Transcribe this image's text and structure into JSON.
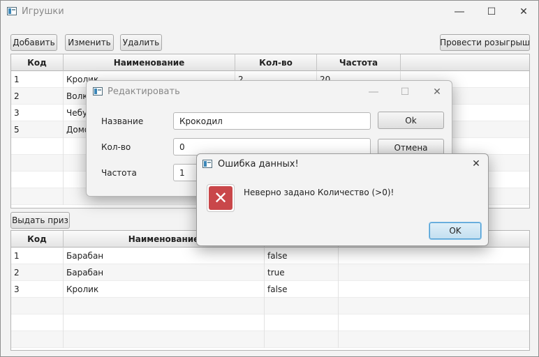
{
  "main": {
    "title": "Игрушки",
    "toolbar": {
      "add": "Добавить",
      "edit": "Изменить",
      "delete": "Удалить",
      "draw": "Провести розыгрыш"
    },
    "toys_table": {
      "headers": [
        "Код",
        "Наименование",
        "Кол-во",
        "Частота"
      ],
      "rows": [
        [
          "1",
          "Кролик",
          "2",
          "20"
        ],
        [
          "2",
          "Волк",
          "",
          ""
        ],
        [
          "3",
          "Чебур",
          "",
          ""
        ],
        [
          "5",
          "Домо",
          "",
          ""
        ]
      ]
    },
    "give_prize": "Выдать приз",
    "prizes_table": {
      "headers": [
        "Код",
        "Наименование",
        ""
      ],
      "rows": [
        [
          "1",
          "Барабан",
          "false"
        ],
        [
          "2",
          "Барабан",
          "true"
        ],
        [
          "3",
          "Кролик",
          "false"
        ]
      ]
    }
  },
  "edit_dialog": {
    "title": "Редактировать",
    "name_label": "Название",
    "name_value": "Крокодил",
    "qty_label": "Кол-во",
    "qty_value": "0",
    "freq_label": "Частота",
    "freq_value": "1",
    "ok": "Ok",
    "cancel": "Отмена"
  },
  "error_dialog": {
    "title": "Ошибка данных!",
    "message": "Неверно задано Количество (>0)!",
    "ok": "OK"
  },
  "icons": {
    "minimize": "minimize-icon",
    "maximize": "maximize-icon",
    "close": "close-icon",
    "error": "error-icon"
  }
}
